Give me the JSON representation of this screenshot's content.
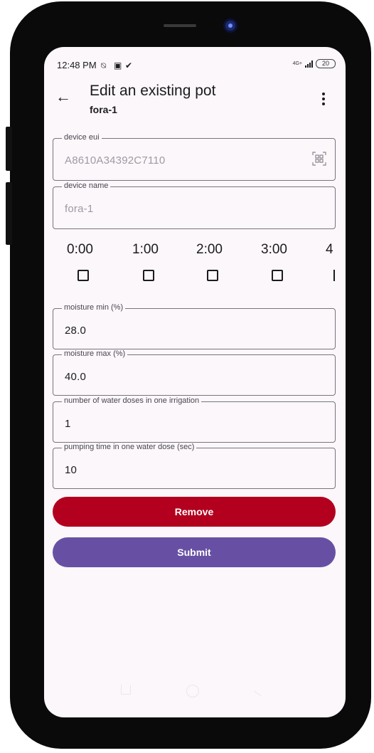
{
  "status_bar": {
    "time": "12:48 PM",
    "network": "4G+",
    "battery": "20"
  },
  "header": {
    "title": "Edit an existing pot",
    "subtitle": "fora-1"
  },
  "fields": {
    "device_eui": {
      "label": "device eui",
      "value": "A8610A34392C7110"
    },
    "device_name": {
      "label": "device name",
      "value": "fora-1"
    },
    "moisture_min": {
      "label": "moisture min (%)",
      "value": "28.0"
    },
    "moisture_max": {
      "label": "moisture max (%)",
      "value": "40.0"
    },
    "water_doses": {
      "label": "number of water doses in one irrigation",
      "value": "1"
    },
    "pumping_time": {
      "label": "pumping time in one water dose (sec)",
      "value": "10"
    }
  },
  "schedule": {
    "hours": [
      "0:00",
      "1:00",
      "2:00",
      "3:00",
      "4"
    ],
    "checked": [
      false,
      false,
      false,
      false,
      false
    ]
  },
  "buttons": {
    "remove": "Remove",
    "submit": "Submit"
  },
  "colors": {
    "remove": "#b3001f",
    "submit": "#6750a4",
    "background": "#fbf7fa"
  },
  "icons": {
    "back": "arrow-back-icon",
    "menu": "more-vert-icon",
    "qr": "qr-scan-icon"
  }
}
